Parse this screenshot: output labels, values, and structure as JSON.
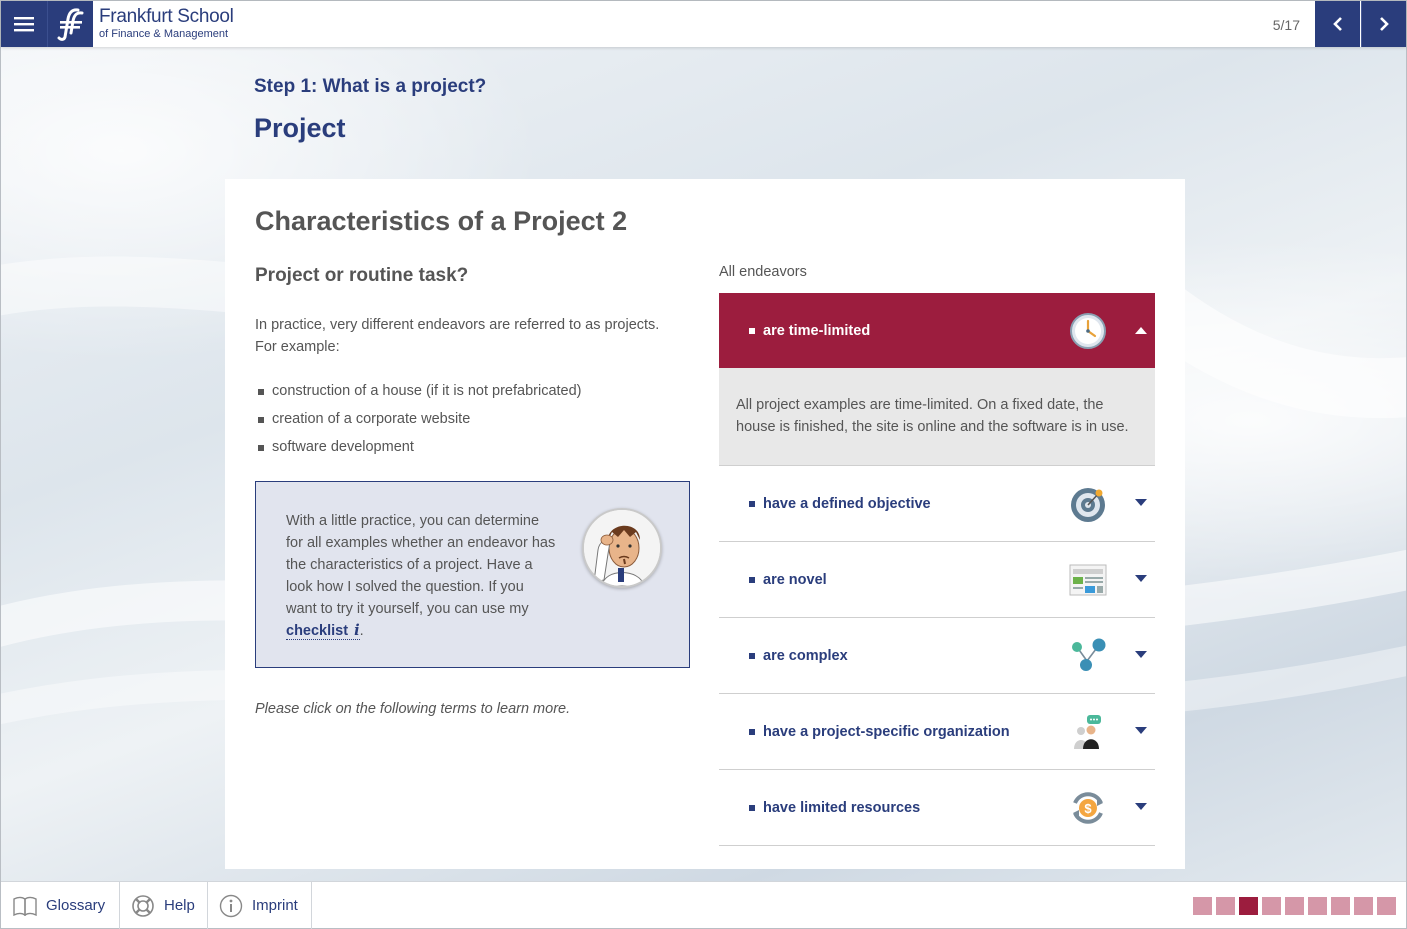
{
  "header": {
    "logo_title": "Frankfurt School",
    "logo_subtitle": "of Finance & Management",
    "page_counter": "5/17"
  },
  "step_title": "Step 1: What is a project?",
  "page_title": "Project",
  "card": {
    "title": "Characteristics of a Project 2",
    "subtitle": "Project or routine task?",
    "intro": "In practice, very different endeavors are referred to as projects. For example:",
    "examples": [
      "construction of a house (if it is not prefabricated)",
      "creation of a corporate website",
      "software development"
    ],
    "tip": {
      "text": "With a little practice, you can determine for all examples whether an endeavor has the characteristics of a project. Have a look how I solved the question. If you want to try it yourself, you can use my",
      "link_label": "checklist",
      "info_glyph": "i",
      "trailing": "."
    },
    "hint": "Please click on the following terms to learn more."
  },
  "accordion": {
    "label": "All endeavors",
    "items": [
      {
        "label": "are time-limited",
        "icon": "clock-icon",
        "open": true,
        "body": "All project examples are time-limited. On a fixed date, the house is finished, the site is online and the software is in use."
      },
      {
        "label": "have a defined objective",
        "icon": "target-icon",
        "open": false
      },
      {
        "label": "are novel",
        "icon": "news-icon",
        "open": false
      },
      {
        "label": "are complex",
        "icon": "network-icon",
        "open": false
      },
      {
        "label": "have a project-specific organization",
        "icon": "people-icon",
        "open": false
      },
      {
        "label": "have limited resources",
        "icon": "money-cycle-icon",
        "open": false
      }
    ]
  },
  "footer": {
    "glossary": "Glossary",
    "help": "Help",
    "imprint": "Imprint",
    "progress_total": 9,
    "progress_current": 3
  },
  "colors": {
    "primary": "#2a3d7c",
    "accent": "#9c1d3e",
    "accent_light": "#d597a8"
  }
}
